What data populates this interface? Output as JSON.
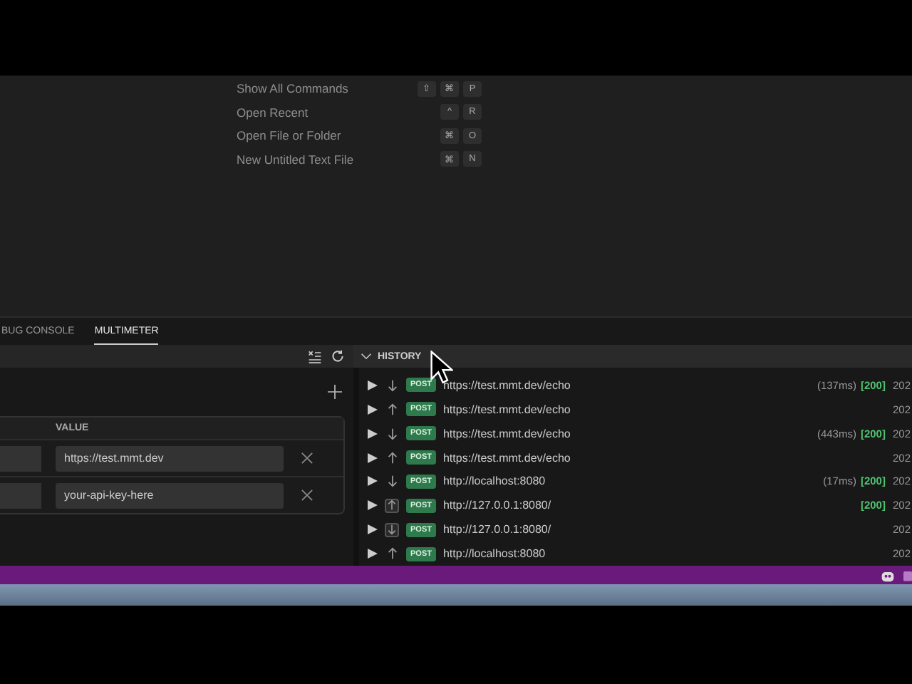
{
  "welcome": {
    "commands": [
      {
        "label": "Show All Commands",
        "keys": [
          "⇧",
          "⌘",
          "P"
        ]
      },
      {
        "label": "Open Recent",
        "keys": [
          "^",
          "R"
        ]
      },
      {
        "label": "Open File or Folder",
        "keys": [
          "⌘",
          "O"
        ]
      },
      {
        "label": "New Untitled Text File",
        "keys": [
          "⌘",
          "N"
        ]
      }
    ]
  },
  "panel_tabs": [
    {
      "label": "BUG CONSOLE",
      "selected": false
    },
    {
      "label": "MULTIMETER",
      "selected": true
    }
  ],
  "variables": {
    "columns": [
      "VALUE"
    ],
    "rows": [
      {
        "value": "https://test.mmt.dev"
      },
      {
        "value": "your-api-key-here"
      }
    ]
  },
  "history": {
    "title": "HISTORY",
    "expanded": true,
    "rows": [
      {
        "kind": "down",
        "boxed": false,
        "method": "POST",
        "url": "https://test.mmt.dev/echo",
        "duration": "(137ms)",
        "status": "[200]",
        "date": "202"
      },
      {
        "kind": "up",
        "boxed": false,
        "method": "POST",
        "url": "https://test.mmt.dev/echo",
        "date": "202"
      },
      {
        "kind": "down",
        "boxed": false,
        "method": "POST",
        "url": "https://test.mmt.dev/echo",
        "duration": "(443ms)",
        "status": "[200]",
        "date": "202"
      },
      {
        "kind": "up",
        "boxed": false,
        "method": "POST",
        "url": "https://test.mmt.dev/echo",
        "date": "202"
      },
      {
        "kind": "down",
        "boxed": false,
        "method": "POST",
        "url": "http://localhost:8080",
        "duration": "(17ms)",
        "status": "[200]",
        "date": "202"
      },
      {
        "kind": "up",
        "boxed": true,
        "method": "POST",
        "url": "http://127.0.0.1:8080/",
        "status": "[200]",
        "date": "202"
      },
      {
        "kind": "down",
        "boxed": true,
        "method": "POST",
        "url": "http://127.0.0.1:8080/",
        "date": "202"
      },
      {
        "kind": "up",
        "boxed": false,
        "method": "POST",
        "url": "http://localhost:8080",
        "date": "202"
      }
    ]
  }
}
